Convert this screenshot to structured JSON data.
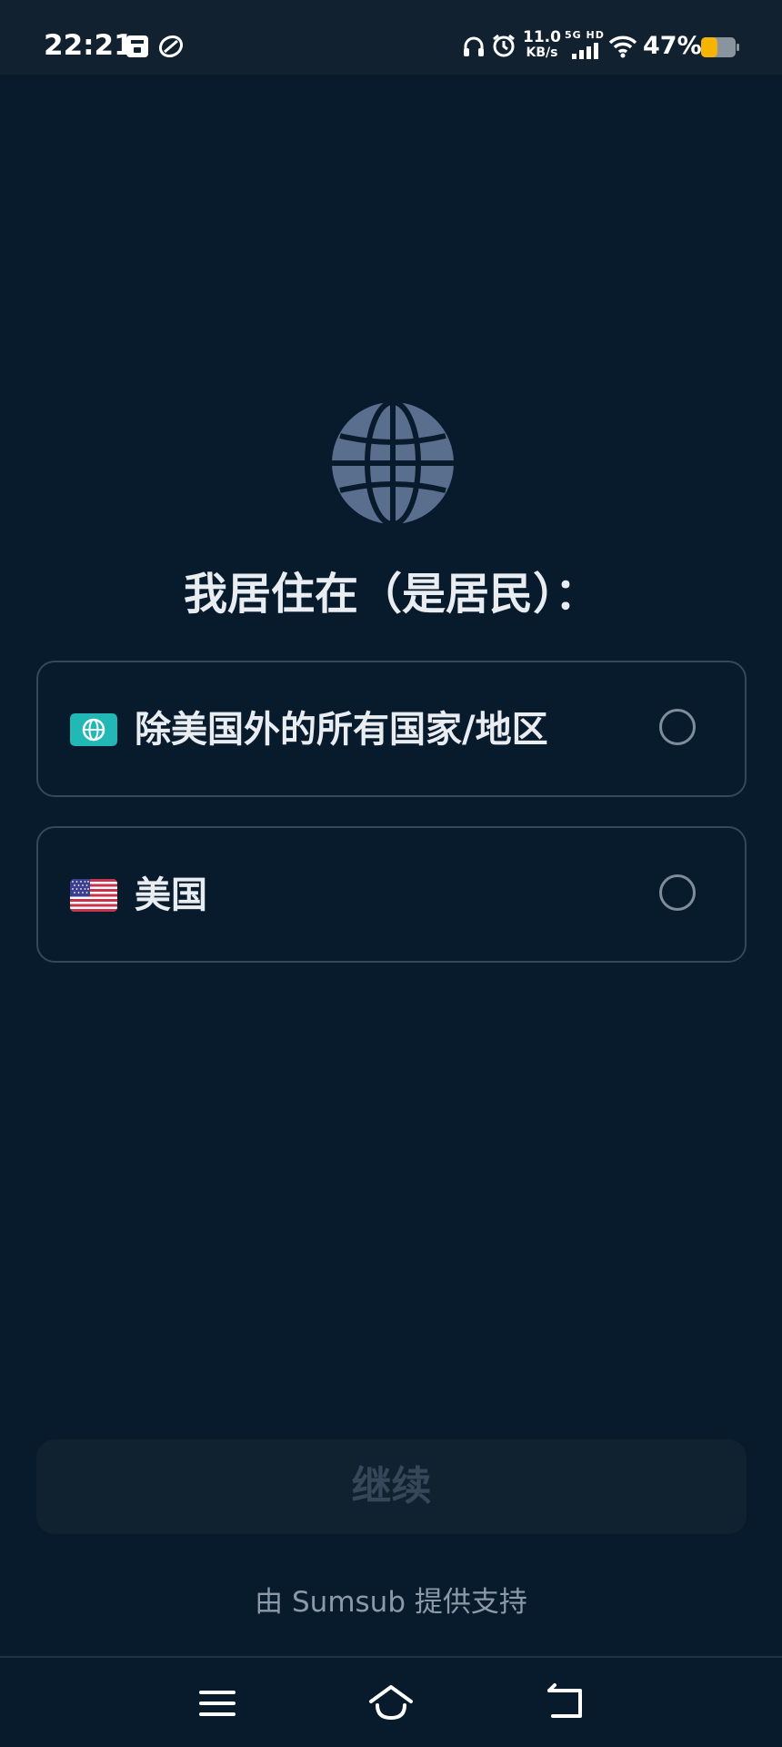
{
  "status_bar": {
    "time": "22:21",
    "speed_value": "11.0",
    "speed_unit": "KB/s",
    "network_label": "5G HD",
    "battery_percent": "47%",
    "battery_level": 0.47,
    "battery_color": "#f5b400",
    "icons": [
      "storage-icon",
      "sync-icon",
      "headphones-icon",
      "alarm-icon",
      "signal-icon",
      "wifi-icon",
      "battery-icon"
    ]
  },
  "hero": {
    "icon": "globe-icon"
  },
  "title": "我居住在（是居民）：",
  "options": [
    {
      "label": "除美国外的所有国家/地区",
      "icon": "globe-badge-icon",
      "selected": false
    },
    {
      "label": "美国",
      "icon": "us-flag-icon",
      "selected": false
    }
  ],
  "continue_button": {
    "label": "继续",
    "enabled": false
  },
  "powered_by": "由 Sumsub 提供支持",
  "nav_bar": {
    "icons": [
      "menu-icon",
      "home-icon",
      "back-icon"
    ]
  },
  "colors": {
    "background": "#071b2d",
    "accent_teal": "#22b8b5",
    "card_border": "#34485a"
  }
}
